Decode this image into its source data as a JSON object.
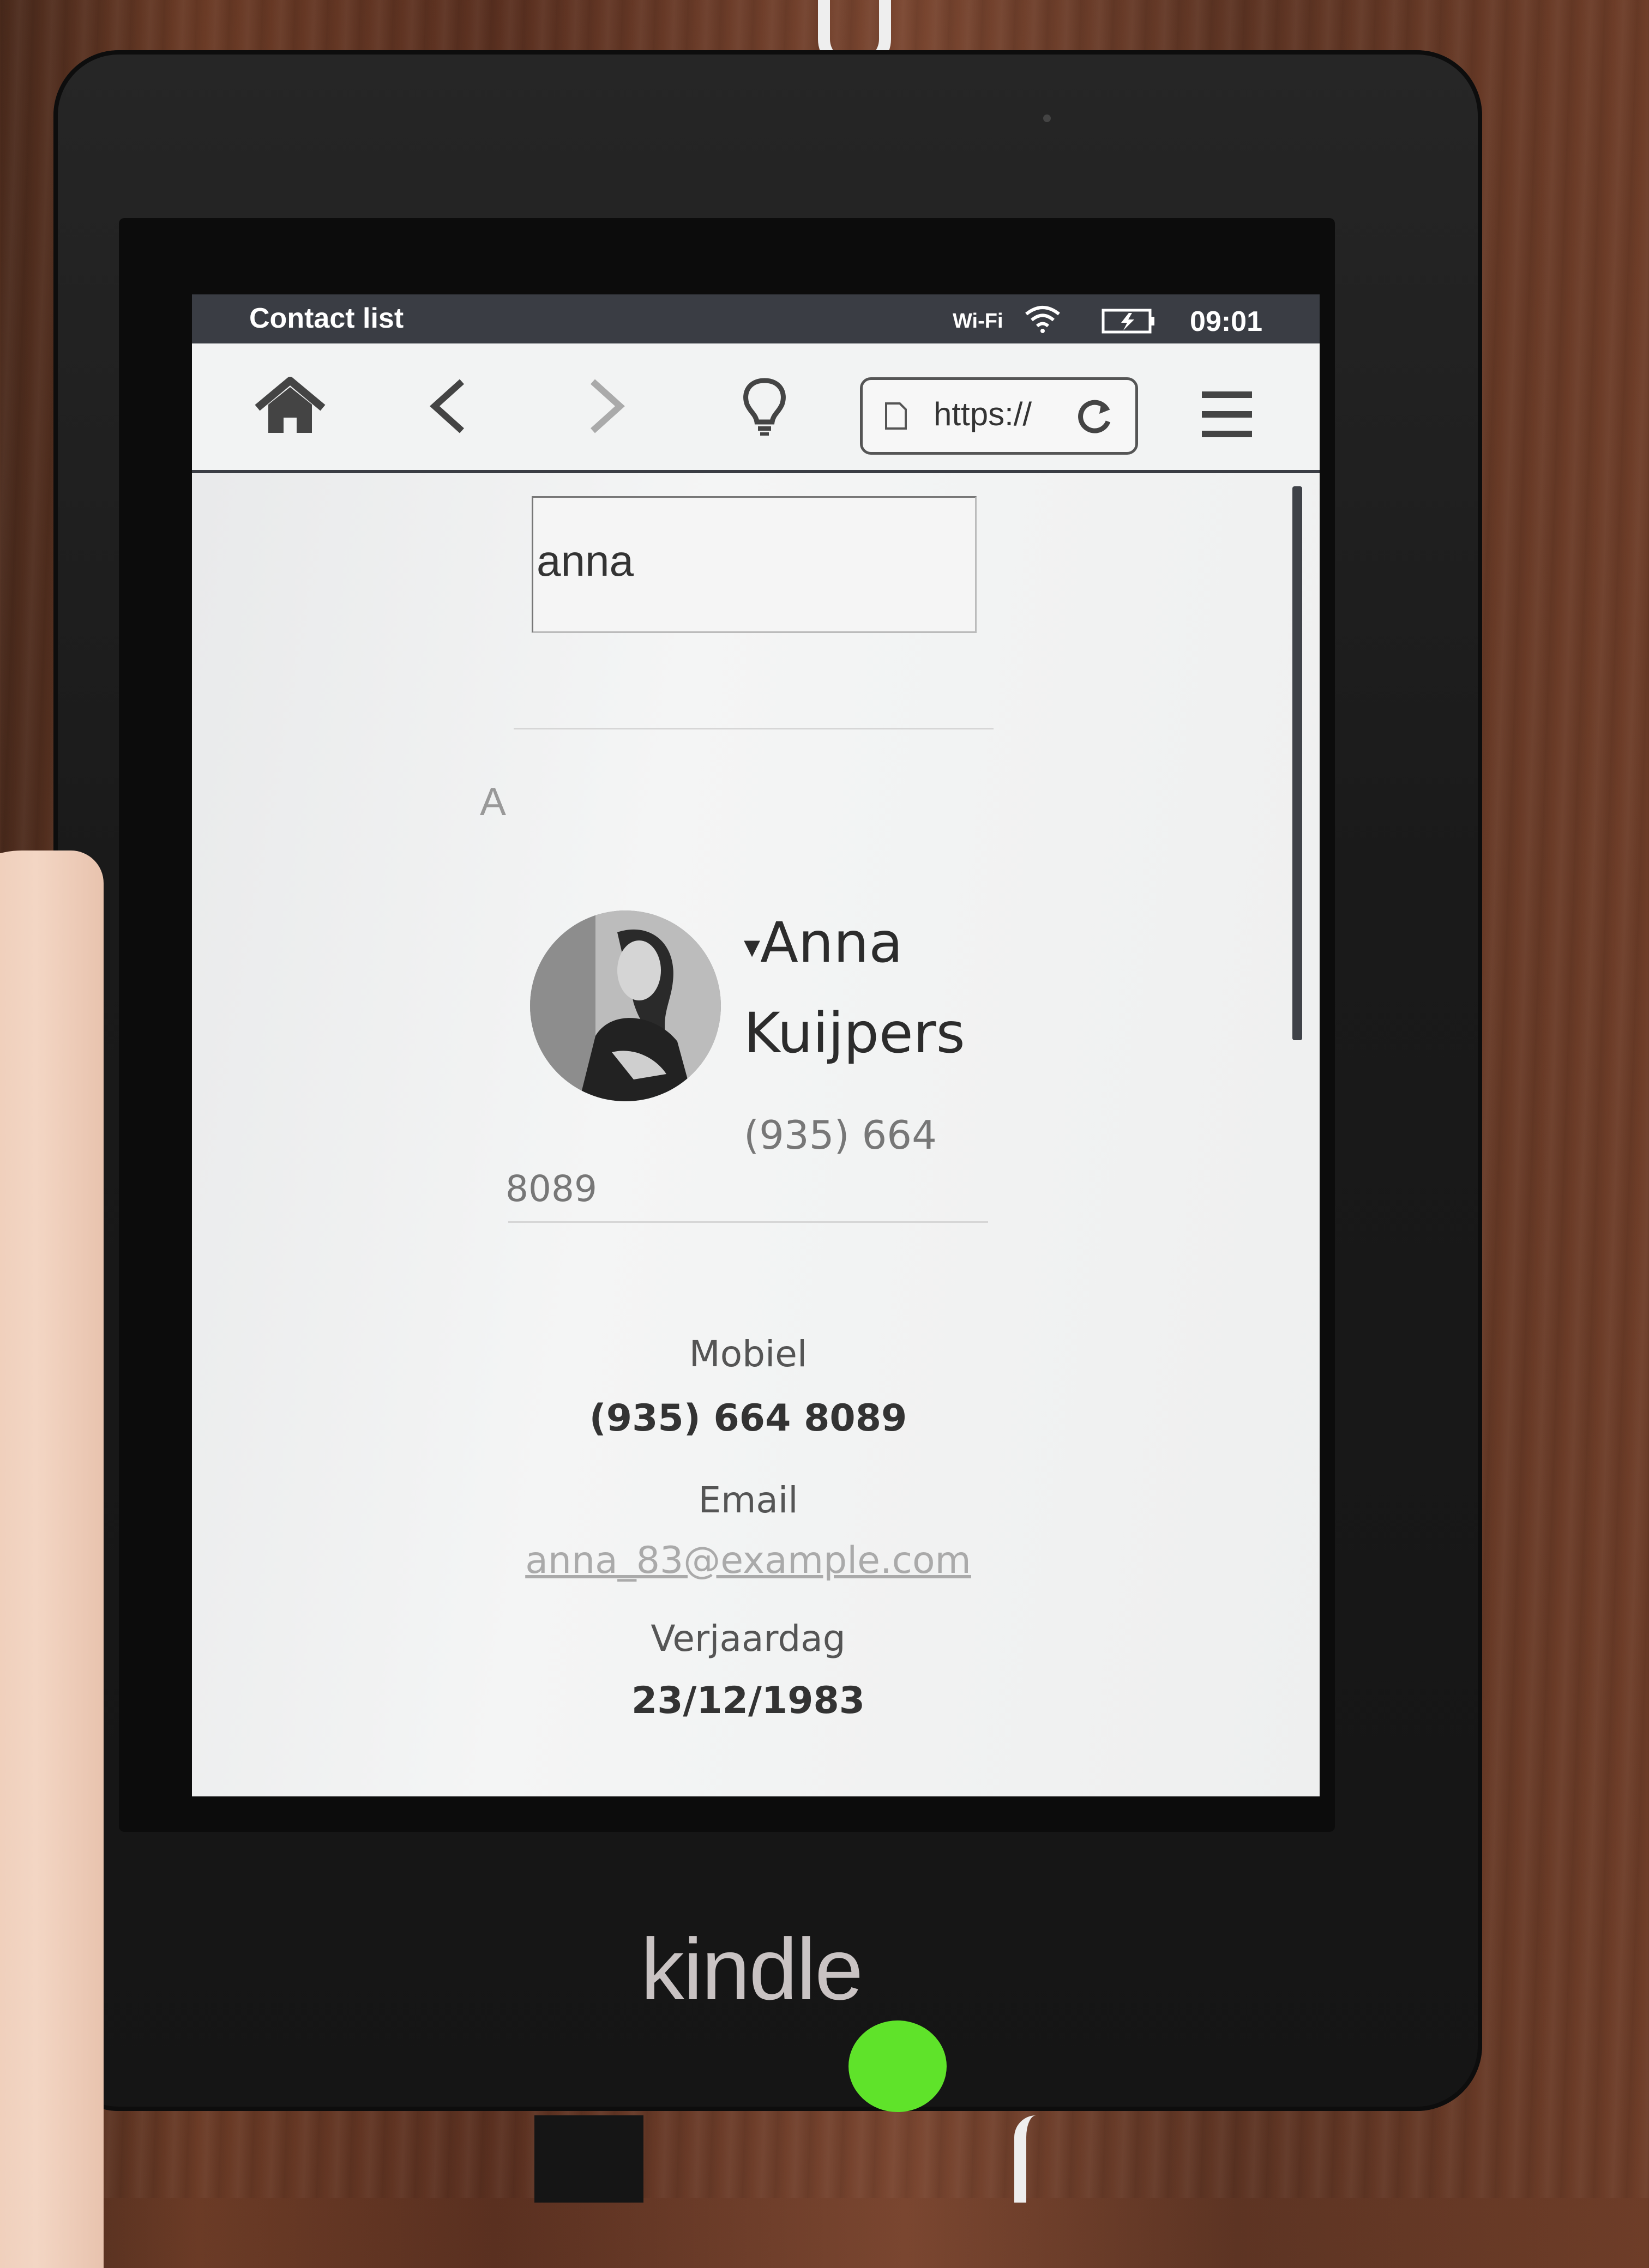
{
  "status_bar": {
    "title": "Contact list",
    "wifi_label": "Wi-Fi",
    "time": "09:01"
  },
  "toolbar": {
    "url": "https://"
  },
  "search": {
    "value": "anna"
  },
  "contacts": {
    "section_letter": "A",
    "name_line1": "Anna",
    "name_line2": "Kuijpers",
    "caret": "▾",
    "phone_part1": "(935) 664",
    "phone_part2": "8089"
  },
  "details": {
    "mobile_label": "Mobiel",
    "mobile_value": "(935) 664 8089",
    "email_label": "Email",
    "email_value": "anna_83@example.com",
    "birthday_label": "Verjaardag",
    "birthday_value": "23/12/1983"
  },
  "device": {
    "brand": "kindle"
  },
  "colors": {
    "status_bar": "#3a3d44",
    "screen": "#f0f1f1",
    "bezel": "#1a1a1a",
    "sticker": "#5fe32a"
  }
}
